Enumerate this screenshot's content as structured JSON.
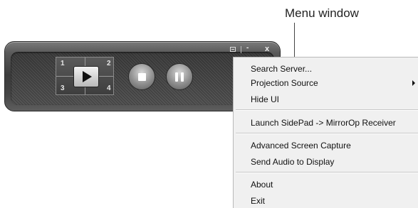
{
  "callout": {
    "label": "Menu window"
  },
  "player": {
    "quadrants": [
      "1",
      "2",
      "3",
      "4"
    ],
    "window_controls": {
      "minimize": "-",
      "close": "x"
    }
  },
  "menu": {
    "items": [
      {
        "label": "Search Server..."
      },
      {
        "label": "Projection Source"
      },
      {
        "label": "Hide UI"
      },
      {
        "label": "Launch SidePad -> MirrorOp Receiver"
      },
      {
        "label": "Advanced Screen Capture"
      },
      {
        "label": "Send Audio to Display"
      },
      {
        "label": "About"
      },
      {
        "label": "Exit"
      }
    ]
  }
}
